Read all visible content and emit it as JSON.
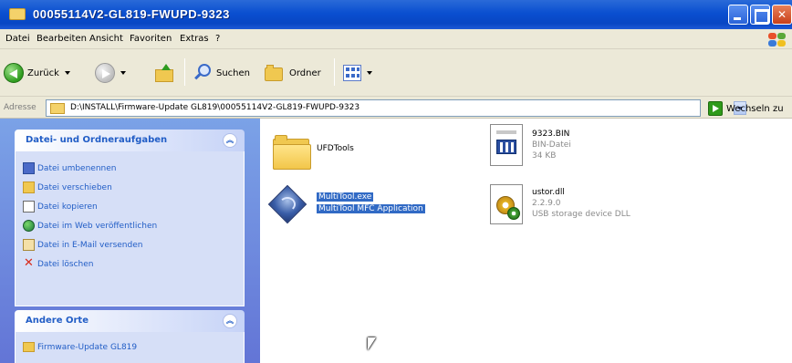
{
  "window": {
    "title": "00055114V2-GL819-FWUPD-9323"
  },
  "menu": [
    "Datei",
    "Bearbeiten",
    "Ansicht",
    "Favoriten",
    "Extras",
    "?"
  ],
  "toolbar": {
    "back_label": "Zurück",
    "search_label": "Suchen",
    "folders_label": "Ordner"
  },
  "address": {
    "label": "Adresse",
    "value": "D:\\INSTALL\\Firmware-Update GL819\\00055114V2-GL819-FWUPD-9323",
    "go_label": "Wechseln zu"
  },
  "task_panels": [
    {
      "title": "Datei- und Ordneraufgaben",
      "tasks": [
        {
          "label": "Datei umbenennen",
          "icon": "rename-icon"
        },
        {
          "label": "Datei verschieben",
          "icon": "move-icon"
        },
        {
          "label": "Datei kopieren",
          "icon": "copy-icon"
        },
        {
          "label": "Datei im Web veröffentlichen",
          "icon": "web-publish-icon"
        },
        {
          "label": "Datei in E-Mail versenden",
          "icon": "email-icon"
        },
        {
          "label": "Datei löschen",
          "icon": "delete-icon"
        }
      ]
    },
    {
      "title": "Andere Orte",
      "tasks": [
        {
          "label": "Firmware-Update GL819",
          "icon": "folder-icon"
        }
      ]
    }
  ],
  "files": [
    {
      "name": "UFDTools",
      "type": "folder"
    },
    {
      "name": "9323.BIN",
      "desc": "BIN-Datei",
      "size": "34 KB",
      "type": "bin"
    },
    {
      "name": "MultiTool.exe",
      "desc": "MultiTool MFC Application",
      "type": "exe",
      "selected": true
    },
    {
      "name": "ustor.dll",
      "desc": "2.2.9.0",
      "extra": "USB storage device DLL",
      "type": "dll"
    }
  ],
  "colors": {
    "titlebar": "#0a4fd0",
    "taskpane": "#6375d6",
    "link": "#215dc6",
    "selection": "#316ac5"
  }
}
